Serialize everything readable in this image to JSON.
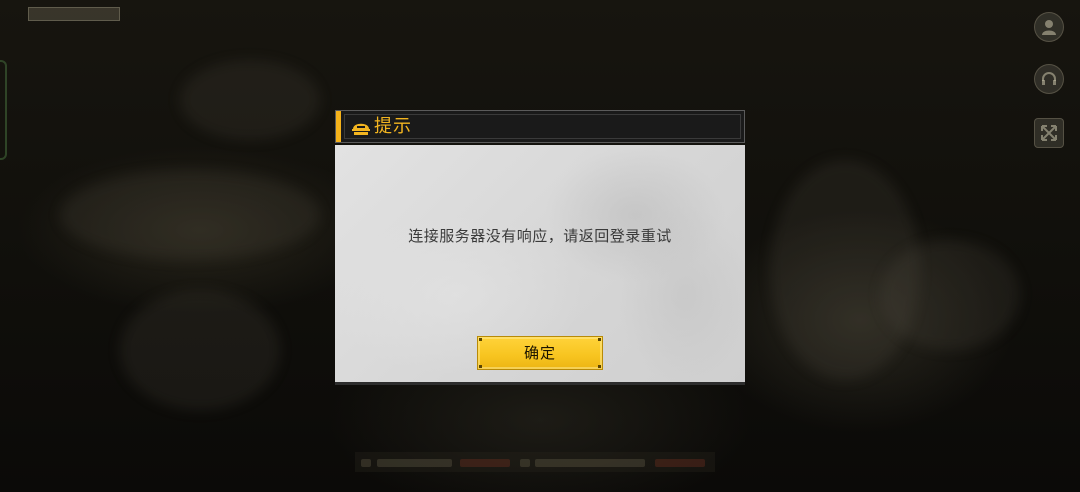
{
  "dialog": {
    "title": "提示",
    "message": "连接服务器没有响应，请返回登录重试",
    "confirm_label": "确定",
    "title_icon": "helmet-icon"
  },
  "background": {
    "side_buttons": [
      {
        "icon": "avatar-icon"
      },
      {
        "icon": "headset-icon"
      },
      {
        "icon": "expand-icon"
      }
    ]
  },
  "colors": {
    "accent": "#f5b21a",
    "title_text": "#f3b520",
    "button_fill": "#f7c41f",
    "dialog_body": "#d9d9d9",
    "header_bg": "#1a1a1a"
  }
}
